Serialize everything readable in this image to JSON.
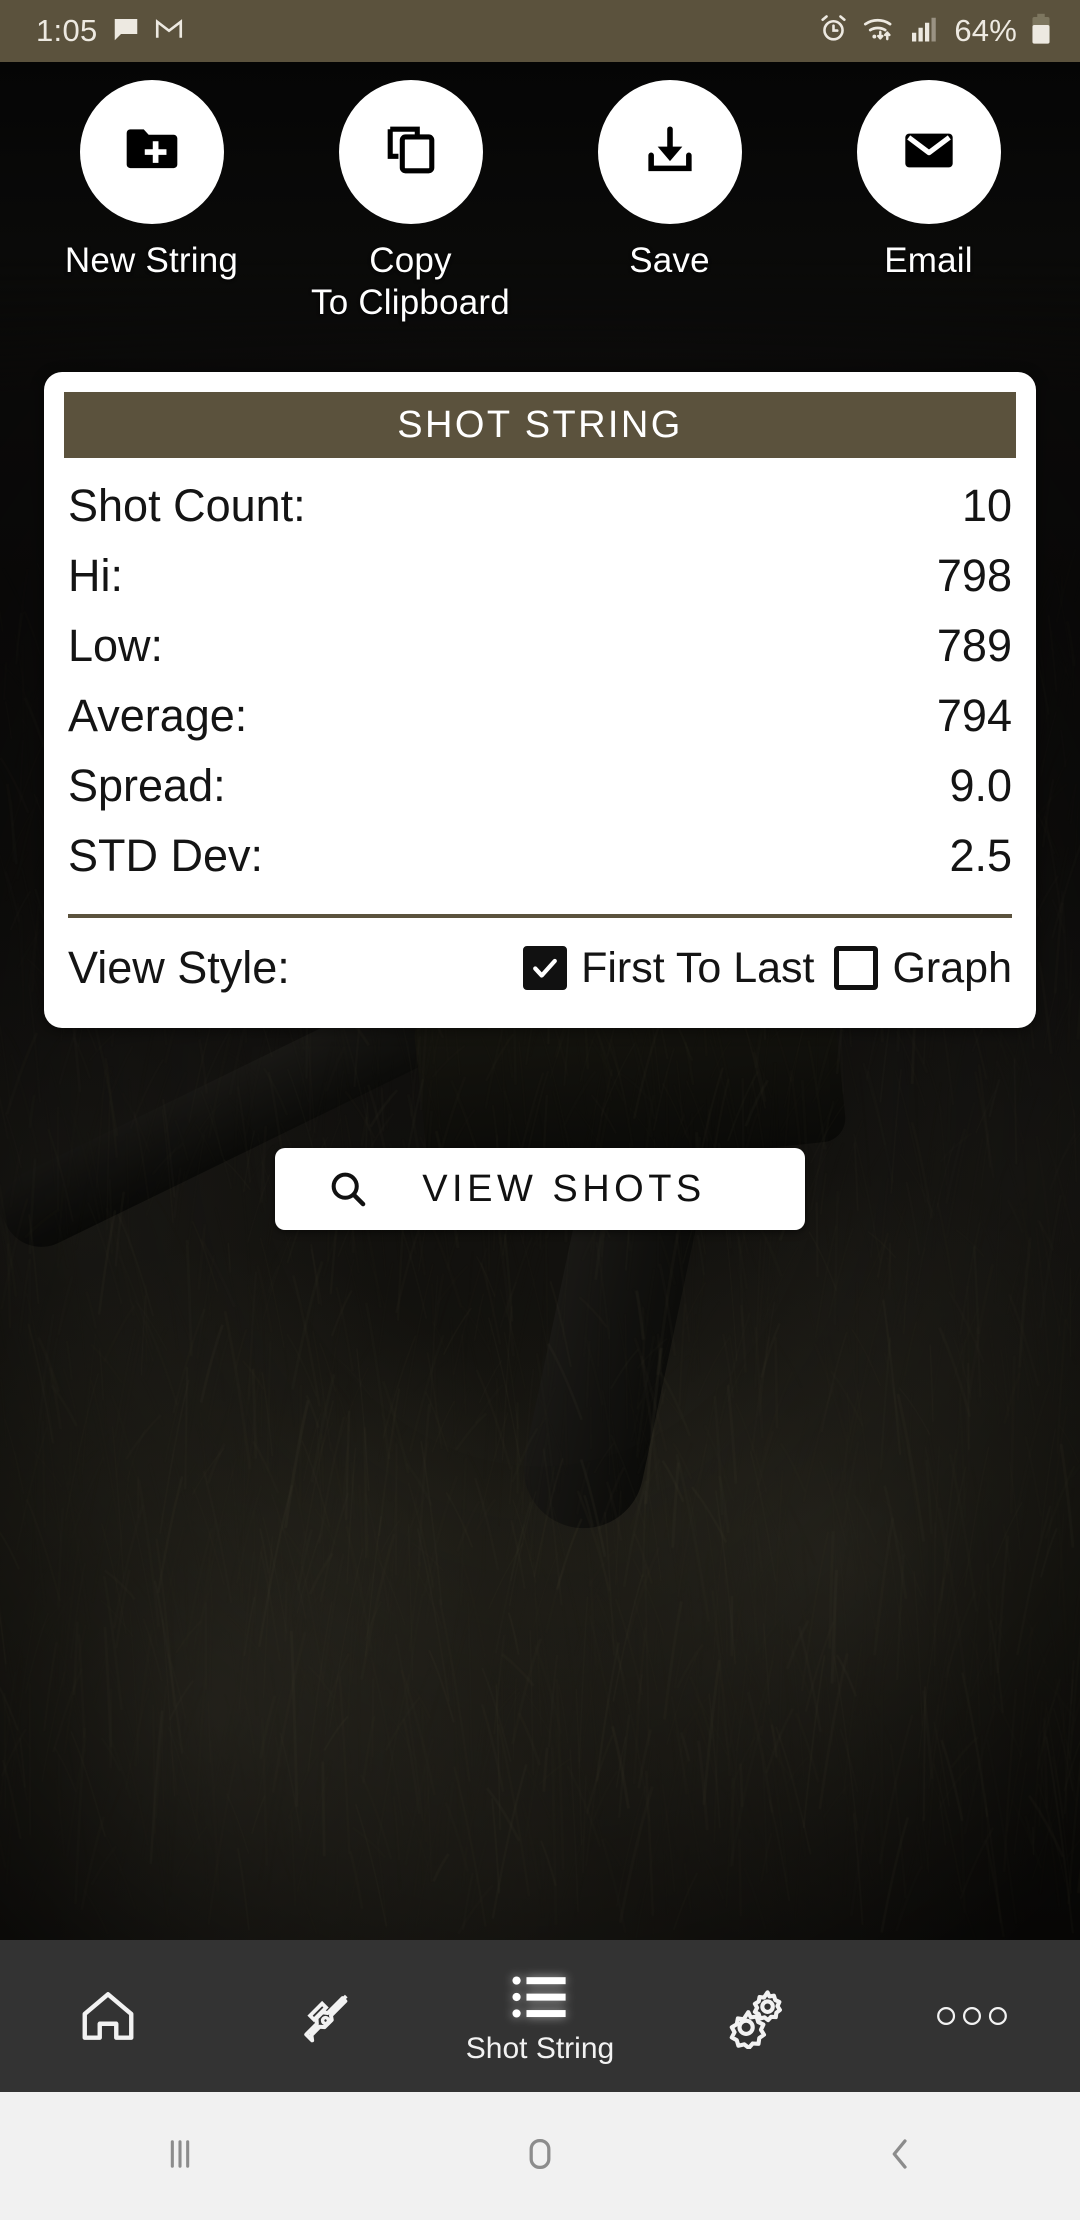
{
  "statusbar": {
    "time": "1:05",
    "battery": "64%",
    "icons": [
      "message-icon",
      "gmail-icon",
      "alarm-icon",
      "wifi-icon",
      "signal-icon",
      "battery-icon"
    ]
  },
  "actions": [
    {
      "label": "New String",
      "icon": "folder-plus-icon"
    },
    {
      "label": "Copy\nTo Clipboard",
      "label_line1": "Copy",
      "label_line2": "To Clipboard",
      "icon": "copy-icon"
    },
    {
      "label": "Save",
      "icon": "download-icon"
    },
    {
      "label": "Email",
      "icon": "envelope-icon"
    }
  ],
  "card": {
    "header_title": "SHOT STRING",
    "stats": [
      {
        "label": "Shot Count:",
        "value": "10"
      },
      {
        "label": "Hi:",
        "value": "798"
      },
      {
        "label": "Low:",
        "value": "789"
      },
      {
        "label": "Average:",
        "value": "794"
      },
      {
        "label": "Spread:",
        "value": "9.0"
      },
      {
        "label": "STD Dev:",
        "value": "2.5"
      }
    ],
    "view_style": {
      "label": "View Style:",
      "options": [
        {
          "label": "First To Last",
          "checked": true
        },
        {
          "label": "Graph",
          "checked": false
        }
      ]
    }
  },
  "view_shots_button": {
    "label": "VIEW SHOTS",
    "icon": "search-icon"
  },
  "bottom_nav": [
    {
      "label": "",
      "icon": "home-icon",
      "active": false
    },
    {
      "label": "",
      "icon": "rifle-icon",
      "active": false
    },
    {
      "label": "Shot String",
      "icon": "list-icon",
      "active": true
    },
    {
      "label": "",
      "icon": "gears-icon",
      "active": false
    },
    {
      "label": "",
      "icon": "more-dots-icon",
      "active": false
    }
  ],
  "system_nav": [
    {
      "icon": "recents-icon"
    },
    {
      "icon": "home-square-icon"
    },
    {
      "icon": "back-icon"
    }
  ],
  "colors": {
    "brand_brown": "#5B523D",
    "card_bg": "#ffffff",
    "nav_bg": "#333333",
    "sysnav_bg": "#f1f1f1"
  }
}
